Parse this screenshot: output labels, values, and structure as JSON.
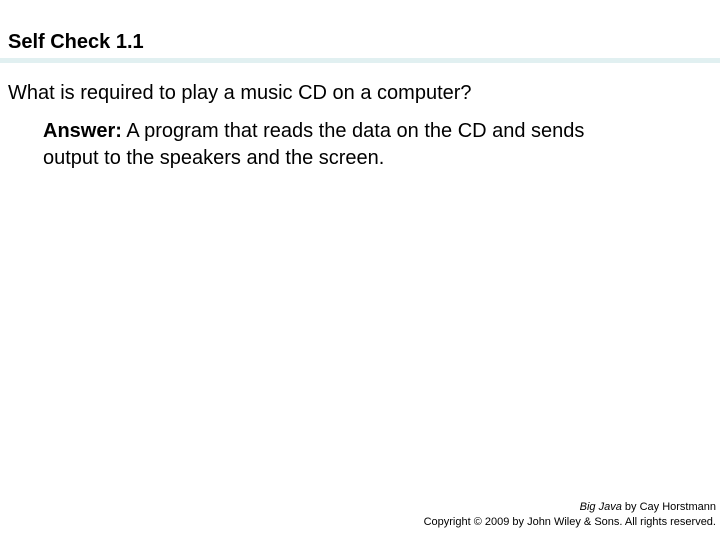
{
  "slide": {
    "title": "Self Check 1.1",
    "question": "What is required to play a music CD on a computer?",
    "answer_label": "Answer:",
    "answer_line1": " A program that reads the data on the CD and sends",
    "answer_line2": "output to the speakers and the screen."
  },
  "footer": {
    "book_title": "Big Java",
    "author_text": " by Cay Horstmann",
    "copyright": "Copyright © 2009 by John Wiley & Sons.  All rights reserved."
  },
  "colors": {
    "divider": "#e1f0f1",
    "text": "#000000",
    "background": "#ffffff"
  }
}
